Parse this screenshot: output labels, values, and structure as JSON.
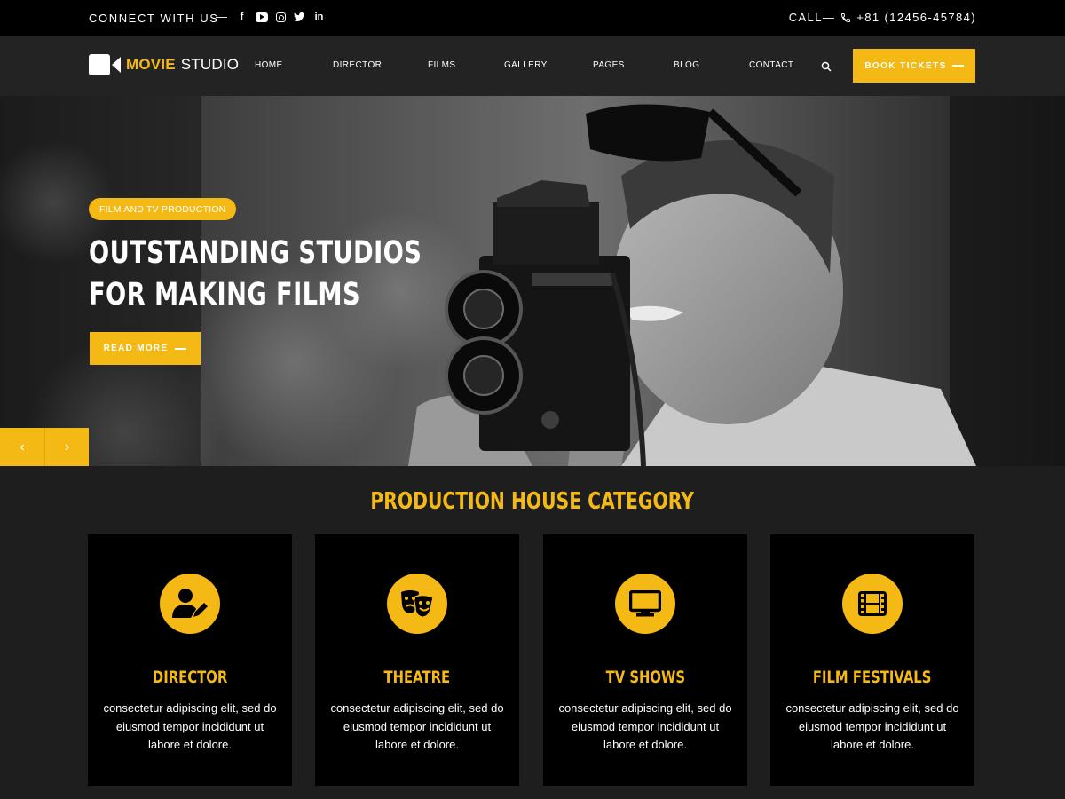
{
  "topbar": {
    "connect_label": "CONNECT WITH US",
    "dash": "—",
    "socials": [
      "facebook-icon",
      "youtube-icon",
      "instagram-icon",
      "twitter-icon",
      "linkedin-icon"
    ],
    "call_label": "CALL—",
    "phone": "+81 (12456-45784)"
  },
  "brand": {
    "part1": "MOVIE",
    "part2": "STUDIO"
  },
  "nav": {
    "items": [
      "HOME",
      "DIRECTOR",
      "FILMS",
      "GALLERY",
      "PAGES",
      "BLOG",
      "CONTACT"
    ],
    "cta_label": "BOOK TICKETS"
  },
  "hero": {
    "badge": "FILM AND TV PRODUCTION",
    "headline_line1": "OUTSTANDING STUDIOS",
    "headline_line2": "FOR MAKING FILMS",
    "button_label": "READ MORE",
    "prev_arrow": "‹",
    "next_arrow": "›"
  },
  "categories": {
    "title": "PRODUCTION HOUSE CATEGORY",
    "items": [
      {
        "title": "DIRECTOR",
        "icon": "user-edit-icon",
        "desc": "consectetur adipiscing elit, sed do eiusmod tempor incididunt ut labore et dolore."
      },
      {
        "title": "THEATRE",
        "icon": "theater-masks-icon",
        "desc": "consectetur adipiscing elit, sed do eiusmod tempor incididunt ut labore et dolore."
      },
      {
        "title": "TV SHOWS",
        "icon": "monitor-icon",
        "desc": "consectetur adipiscing elit, sed do eiusmod tempor incididunt ut labore et dolore."
      },
      {
        "title": "FILM FESTIVALS",
        "icon": "film-icon",
        "desc": "consectetur adipiscing elit, sed do eiusmod tempor incididunt ut labore et dolore."
      }
    ]
  },
  "colors": {
    "accent": "#f5b915",
    "topbar": "#000000",
    "navbar": "#232323",
    "page": "#1e1e1e",
    "card": "#000000"
  }
}
